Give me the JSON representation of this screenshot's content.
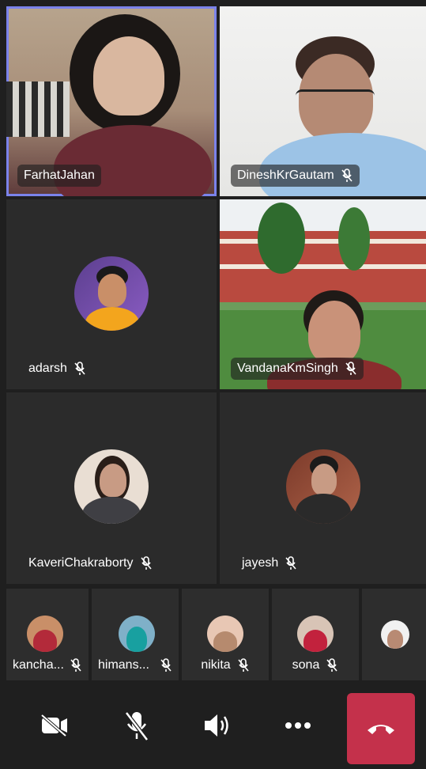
{
  "participants": [
    {
      "name": "FarhatJahan",
      "muted": false
    },
    {
      "name": "DineshKrGautam",
      "muted": true
    },
    {
      "name": "adarsh",
      "muted": true
    },
    {
      "name": "VandanaKmSingh",
      "muted": true
    },
    {
      "name": "KaveriChakraborty",
      "muted": true
    },
    {
      "name": "jayesh",
      "muted": true
    }
  ],
  "strip": [
    {
      "name": "kancha...",
      "muted": true
    },
    {
      "name": "himans...",
      "muted": true
    },
    {
      "name": "nikita",
      "muted": true
    },
    {
      "name": "sona",
      "muted": true
    },
    {
      "name": "",
      "muted": false
    }
  ],
  "controls": {
    "camera": "camera-off-icon",
    "mic": "mic-off-icon",
    "speaker": "speaker-icon",
    "more": "more-icon",
    "hangup": "hang-up-icon",
    "hangup_color": "#c4314b"
  },
  "colors": {
    "active_speaker": "#7b83eb",
    "background": "#1f1f1f",
    "tile": "#2b2b2b"
  }
}
